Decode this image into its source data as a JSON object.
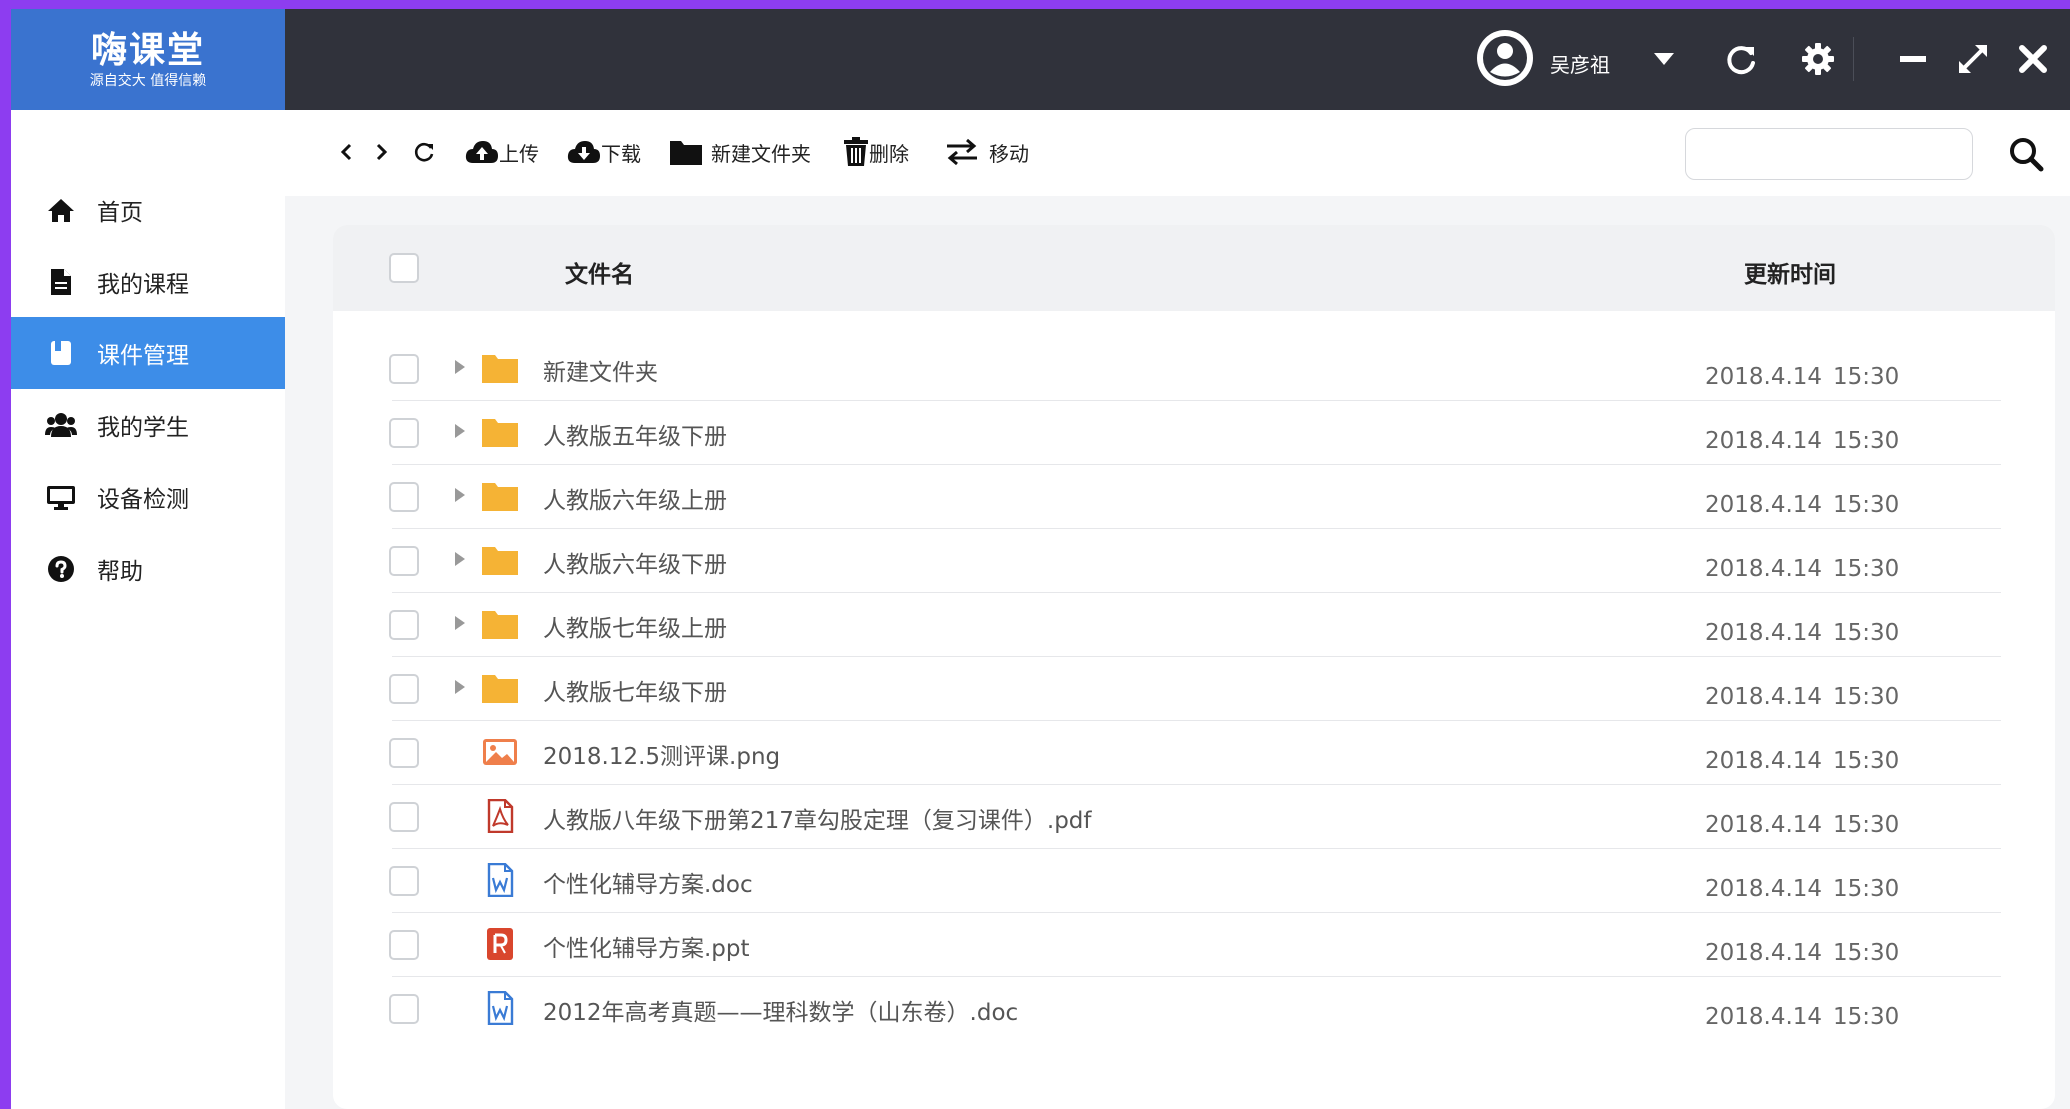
{
  "app": {
    "name": "嗨课堂",
    "slogan": "源自交大 值得信赖"
  },
  "user": {
    "name": "吴彦祖"
  },
  "window_controls": [
    "refresh-icon",
    "gear-icon",
    "minimize-icon",
    "expand-icon",
    "close-icon"
  ],
  "sidebar": {
    "items": [
      {
        "label": "首页",
        "icon": "home-icon"
      },
      {
        "label": "我的课程",
        "icon": "document-icon"
      },
      {
        "label": "课件管理",
        "icon": "book-icon",
        "active": true
      },
      {
        "label": "我的学生",
        "icon": "users-icon"
      },
      {
        "label": "设备检测",
        "icon": "monitor-icon"
      },
      {
        "label": "帮助",
        "icon": "help-icon"
      }
    ]
  },
  "toolbar": {
    "upload": "上传",
    "download": "下载",
    "new_folder": "新建文件夹",
    "delete": "删除",
    "move": "移动",
    "search_placeholder": ""
  },
  "table": {
    "columns": {
      "name": "文件名",
      "updated": "更新时间"
    },
    "rows": [
      {
        "name": "新建文件夹",
        "type": "folder",
        "date": "2018.4.14",
        "time": "15:30"
      },
      {
        "name": "人教版五年级下册",
        "type": "folder",
        "date": "2018.4.14",
        "time": "15:30"
      },
      {
        "name": "人教版六年级上册",
        "type": "folder",
        "date": "2018.4.14",
        "time": "15:30"
      },
      {
        "name": "人教版六年级下册",
        "type": "folder",
        "date": "2018.4.14",
        "time": "15:30"
      },
      {
        "name": "人教版七年级上册",
        "type": "folder",
        "date": "2018.4.14",
        "time": "15:30"
      },
      {
        "name": "人教版七年级下册",
        "type": "folder",
        "date": "2018.4.14",
        "time": "15:30"
      },
      {
        "name": "2018.12.5测评课.png",
        "type": "image",
        "date": "2018.4.14",
        "time": "15:30"
      },
      {
        "name": "人教版八年级下册第217章勾股定理（复习课件）.pdf",
        "type": "pdf",
        "date": "2018.4.14",
        "time": "15:30"
      },
      {
        "name": "个性化辅导方案.doc",
        "type": "doc",
        "date": "2018.4.14",
        "time": "15:30"
      },
      {
        "name": "个性化辅导方案.ppt",
        "type": "ppt",
        "date": "2018.4.14",
        "time": "15:30"
      },
      {
        "name": "2012年高考真题——理科数学（山东卷）.doc",
        "type": "doc",
        "date": "2018.4.14",
        "time": "15:30"
      }
    ]
  },
  "colors": {
    "accent": "#3d8de8",
    "logo_bg": "#3a73cf",
    "topbar_bg": "#30323b",
    "folder": "#f5b335",
    "image_icon": "#ef7f4b",
    "pdf_icon": "#c0392b",
    "doc_icon": "#3a7bd5",
    "ppt_icon": "#d9462d"
  }
}
